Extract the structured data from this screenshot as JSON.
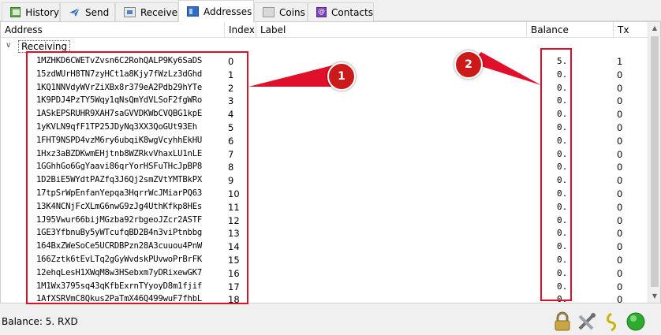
{
  "tabs": [
    {
      "label": "History",
      "icon": "history-icon",
      "active": false
    },
    {
      "label": "Send",
      "icon": "send-icon",
      "active": false
    },
    {
      "label": "Receive",
      "icon": "receive-icon",
      "active": false
    },
    {
      "label": "Addresses",
      "icon": "addresses-icon",
      "active": true
    },
    {
      "label": "Coins",
      "icon": "coins-icon",
      "active": false
    },
    {
      "label": "Contacts",
      "icon": "contacts-icon",
      "active": false
    }
  ],
  "table": {
    "headers": {
      "address": "Address",
      "index": "Index",
      "label": "Label",
      "balance": "Balance",
      "tx": "Tx"
    },
    "group_label": "Receiving",
    "rows": [
      {
        "address": "1MZHKD6CWETvZvsn6C2RohQALP9Ky6SaDS",
        "index": "0",
        "balance": "5.",
        "tx": "1"
      },
      {
        "address": "15zdWUrH8TN7zyHCt1a8Kjy7fWzLz3dGhd",
        "index": "1",
        "balance": "0.",
        "tx": "0"
      },
      {
        "address": "1KQ1NNVdyWVrZiXBx8r379eA2Pdb29hYTe",
        "index": "2",
        "balance": "0.",
        "tx": "0"
      },
      {
        "address": "1K9PDJ4PzTY5Wqy1qNsQmYdVLSoF2fgWRo",
        "index": "3",
        "balance": "0.",
        "tx": "0"
      },
      {
        "address": "1ASkEPSRUHR9XAH7saGVVDKWbCVQBG1kpE",
        "index": "4",
        "balance": "0.",
        "tx": "0"
      },
      {
        "address": "1yKVLN9qfF1TP25JDyNq3XX3QoGUt93Eh",
        "index": "5",
        "balance": "0.",
        "tx": "0"
      },
      {
        "address": "1FHT9NSPD4vzM6ry6ubqiK8wgVcyhhEkHU",
        "index": "6",
        "balance": "0.",
        "tx": "0"
      },
      {
        "address": "1Hxz3aBZDKwmEHjtnb8WZRkvVhaxLU1nLE",
        "index": "7",
        "balance": "0.",
        "tx": "0"
      },
      {
        "address": "1GGhhGo6GgYaavi86qrYorHSFuTHcJpBP8",
        "index": "8",
        "balance": "0.",
        "tx": "0"
      },
      {
        "address": "1D2BiE5WYdtPAZfq3J6Qj2smZVtYMTBkPX",
        "index": "9",
        "balance": "0.",
        "tx": "0"
      },
      {
        "address": "17tpSrWpEnfanYepqa3HqrrWcJMiarPQ63",
        "index": "10",
        "balance": "0.",
        "tx": "0"
      },
      {
        "address": "13K4NCNjFcXLmG6nwG9zJg4UthKfkp8HEs",
        "index": "11",
        "balance": "0.",
        "tx": "0"
      },
      {
        "address": "1J95Vwur66bijMGzba92rbgeoJZcr2ASTF",
        "index": "12",
        "balance": "0.",
        "tx": "0"
      },
      {
        "address": "1GE3YfbnuBy5yWTcufqBD2B4n3viPtnbbg",
        "index": "13",
        "balance": "0.",
        "tx": "0"
      },
      {
        "address": "164BxZWeSoCe5UCRDBPzn28A3cuuou4PnW",
        "index": "14",
        "balance": "0.",
        "tx": "0"
      },
      {
        "address": "166Zztk6tEvLTq2gGyWvdskPUvwoPrBrFK",
        "index": "15",
        "balance": "0.",
        "tx": "0"
      },
      {
        "address": "12ehqLesH1XWqM8w3HSebxm7yDRixewGK7",
        "index": "16",
        "balance": "0.",
        "tx": "0"
      },
      {
        "address": "1M1Wx3795sq43qKfbExrnTYyoyD8m1fjif",
        "index": "17",
        "balance": "0.",
        "tx": "0"
      },
      {
        "address": "1AfXSRVmC8Qkus2PaTmX46Q499wuF7fhbL",
        "index": "18",
        "balance": "0.",
        "tx": "0"
      }
    ]
  },
  "annotations": [
    {
      "badge": "1"
    },
    {
      "badge": "2"
    }
  ],
  "status": {
    "balance_text": "Balance: 5. RXD",
    "icons": [
      "lock-icon",
      "tools-icon",
      "seed-icon",
      "network-status-icon"
    ]
  },
  "colors": {
    "annotation_red": "#e0102a",
    "badge_red": "#cc1a1a",
    "network_green": "#2eaa2e"
  }
}
